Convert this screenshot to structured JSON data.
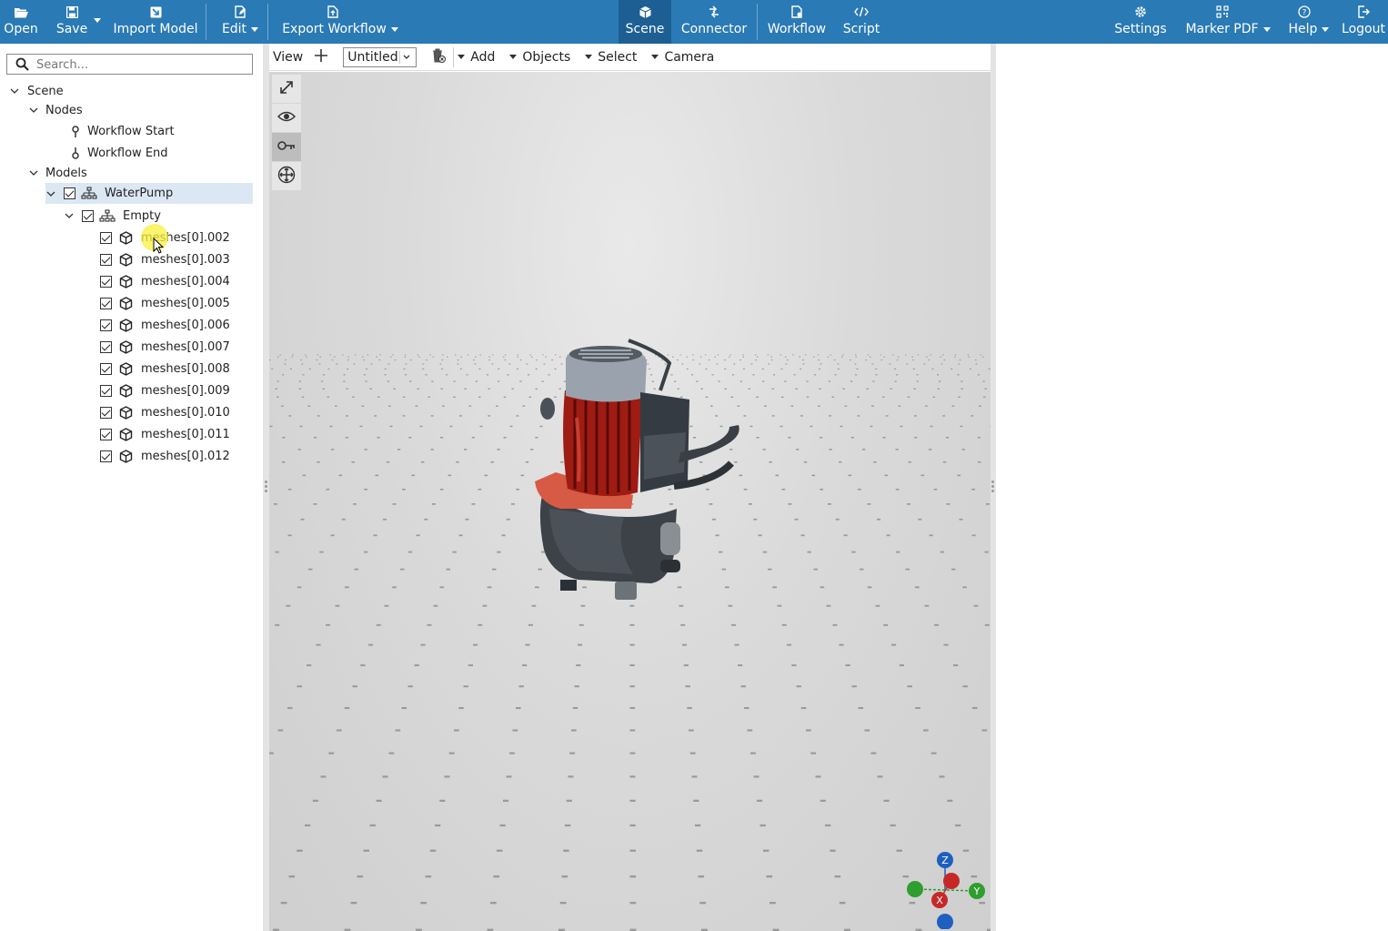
{
  "topbar": {
    "left": [
      {
        "key": "open",
        "label": "Open",
        "icon": "folder-open-icon"
      },
      {
        "key": "save",
        "label": "Save",
        "icon": "floppy-icon"
      },
      {
        "key": "import",
        "label": "Import Model",
        "icon": "import-icon"
      },
      {
        "key": "edit",
        "label": "Edit",
        "icon": "edit-icon"
      },
      {
        "key": "export",
        "label": "Export Workflow",
        "icon": "export-icon"
      }
    ],
    "center": [
      {
        "key": "scene",
        "label": "Scene",
        "icon": "scene-icon",
        "active": true
      },
      {
        "key": "connector",
        "label": "Connector",
        "icon": "connector-icon"
      },
      {
        "key": "workflow",
        "label": "Workflow",
        "icon": "workflow-icon"
      },
      {
        "key": "script",
        "label": "Script",
        "icon": "code-icon"
      }
    ],
    "right": [
      {
        "key": "settings",
        "label": "Settings",
        "icon": "gear-icon"
      },
      {
        "key": "marker",
        "label": "Marker PDF",
        "icon": "qr-icon"
      },
      {
        "key": "help",
        "label": "Help",
        "icon": "help-icon"
      },
      {
        "key": "logout",
        "label": "Logout",
        "icon": "logout-icon"
      }
    ],
    "colors": {
      "bar": "#2a7ab5",
      "active": "#1d5f93"
    }
  },
  "sidebar": {
    "search": {
      "placeholder": "Search...",
      "value": ""
    },
    "tree": {
      "scene": "Scene",
      "nodes": "Nodes",
      "workflow_start": "Workflow Start",
      "workflow_end": "Workflow End",
      "models": "Models",
      "waterpump": "WaterPump",
      "empty": "Empty",
      "meshes": [
        "meshes[0].002",
        "meshes[0].003",
        "meshes[0].004",
        "meshes[0].005",
        "meshes[0].006",
        "meshes[0].007",
        "meshes[0].008",
        "meshes[0].009",
        "meshes[0].010",
        "meshes[0].011",
        "meshes[0].012"
      ]
    }
  },
  "viewport_toolbar": {
    "view_label": "View",
    "view_select": "Untitled",
    "add": "Add",
    "objects": "Objects",
    "select": "Select",
    "camera": "Camera"
  },
  "viewport": {
    "tools": [
      "fullscreen-icon",
      "eye-icon",
      "key-icon",
      "move-icon"
    ],
    "axes": {
      "z": "Z",
      "y": "Y",
      "x": "X"
    },
    "axis_colors": {
      "x": "#c62828",
      "y": "#2e9e2e",
      "z": "#1f5fbf"
    }
  }
}
